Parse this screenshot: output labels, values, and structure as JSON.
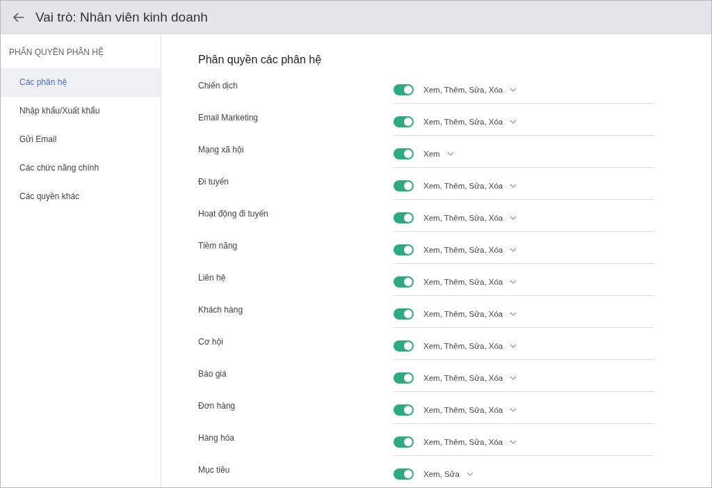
{
  "header": {
    "title": "Vai trò: Nhân viên kinh doanh"
  },
  "sidebar": {
    "heading": "PHÂN QUYỀN PHÂN HỆ",
    "items": [
      {
        "label": "Các phân hệ",
        "selected": true
      },
      {
        "label": "Nhập khẩu/Xuất khẩu",
        "selected": false
      },
      {
        "label": "Gửi Email",
        "selected": false
      },
      {
        "label": "Các chức năng chính",
        "selected": false
      },
      {
        "label": "Các quyền khác",
        "selected": false
      }
    ]
  },
  "content": {
    "title": "Phân quyền các phân hệ",
    "rows": [
      {
        "label": "Chiến dịch",
        "on": true,
        "value": "Xem, Thêm, Sửa, Xóa"
      },
      {
        "label": "Email Marketing",
        "on": true,
        "value": "Xem, Thêm, Sửa, Xóa"
      },
      {
        "label": "Mạng xã hội",
        "on": true,
        "value": "Xem"
      },
      {
        "label": "Đi tuyến",
        "on": true,
        "value": "Xem, Thêm, Sửa, Xóa"
      },
      {
        "label": "Hoạt động đi tuyến",
        "on": true,
        "value": "Xem, Thêm, Sửa, Xóa"
      },
      {
        "label": "Tiềm năng",
        "on": true,
        "value": "Xem, Thêm, Sửa, Xóa"
      },
      {
        "label": "Liên hệ",
        "on": true,
        "value": "Xem, Thêm, Sửa, Xóa"
      },
      {
        "label": "Khách hàng",
        "on": true,
        "value": "Xem, Thêm, Sửa, Xóa"
      },
      {
        "label": "Cơ hội",
        "on": true,
        "value": "Xem, Thêm, Sửa, Xóa"
      },
      {
        "label": "Báo giá",
        "on": true,
        "value": "Xem, Thêm, Sửa, Xóa"
      },
      {
        "label": "Đơn hàng",
        "on": true,
        "value": "Xem, Thêm, Sửa, Xóa"
      },
      {
        "label": "Hàng hóa",
        "on": true,
        "value": "Xem, Thêm, Sửa, Xóa"
      },
      {
        "label": "Mục tiêu",
        "on": true,
        "value": "Xem, Sửa"
      }
    ]
  }
}
